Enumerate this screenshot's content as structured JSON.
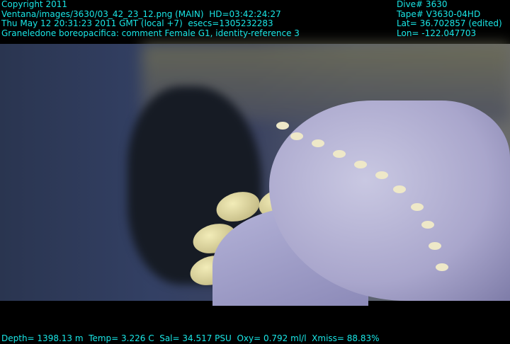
{
  "overlay_top_left": {
    "copyright": "Copyright 2011",
    "image_path": "Ventana/images/3630/03_42_23_12.png (MAIN)  HD=03:42:24:27",
    "datetime": "Thu May 12 20:31:23 2011 GMT (local +7)  esecs=1305232283",
    "annotation": "Graneledone boreopacifica: comment Female G1, identity-reference 3"
  },
  "overlay_top_right": {
    "dive": "Dive# 3630",
    "tape": "Tape# V3630-04HD",
    "lat": "Lat= 36.702857 (edited)",
    "lon": "Lon= -122.047703"
  },
  "overlay_bottom": {
    "sensors": "Depth= 1398.13 m  Temp= 3.226 C  Sal= 34.517 PSU  Oxy= 0.792 ml/l  Xmiss= 88.83%"
  },
  "colors": {
    "overlay_text": "#19e6e6"
  }
}
